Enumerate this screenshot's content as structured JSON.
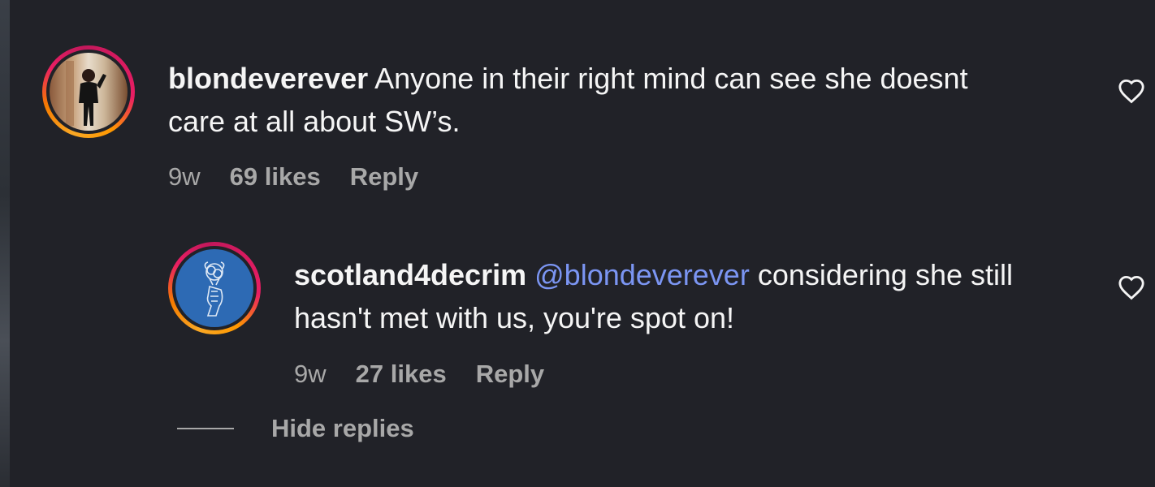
{
  "comments": [
    {
      "username": "blondeverever",
      "text_line1": "Anyone in their right mind can see she doesnt",
      "text_line2": "care at all about SW’s.",
      "time": "9w",
      "likes": "69 likes",
      "reply_label": "Reply",
      "avatar_icon": "profile-photo"
    },
    {
      "username": "scotland4decrim",
      "mention": "@blondeverever",
      "text_line1": "considering she still",
      "text_line2": "hasn't met with us, you're spot on!",
      "time": "9w",
      "likes": "27 likes",
      "reply_label": "Reply",
      "avatar_icon": "fist-flower-logo"
    }
  ],
  "hide_replies_label": "Hide replies",
  "colors": {
    "background": "#212228",
    "text": "#f5f5f5",
    "meta": "#a8a8a8",
    "mention": "#7b95f2",
    "logo_blue": "#2d6ab4"
  },
  "icons": {
    "like": "heart-outline-icon"
  }
}
